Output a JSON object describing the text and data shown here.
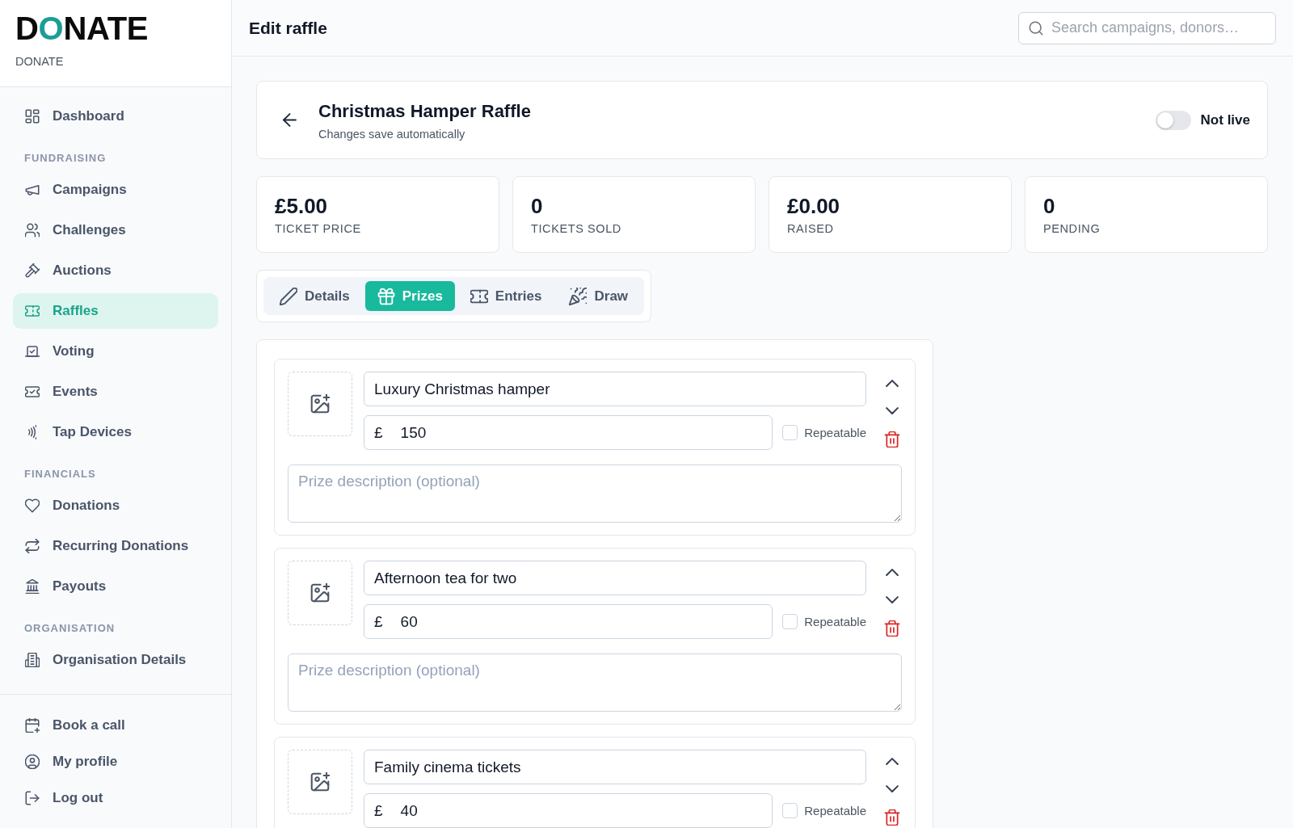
{
  "sidebar": {
    "logo": "DONATE",
    "org_name": "DONATE",
    "nav_groups": [
      {
        "items": [
          {
            "label": "Dashboard",
            "selected": false
          }
        ]
      },
      {
        "heading": "FUNDRAISING",
        "items": [
          {
            "label": "Campaigns",
            "selected": false
          },
          {
            "label": "Challenges",
            "selected": false
          },
          {
            "label": "Auctions",
            "selected": false
          },
          {
            "label": "Raffles",
            "selected": true
          },
          {
            "label": "Voting",
            "selected": false
          },
          {
            "label": "Events",
            "selected": false
          },
          {
            "label": "Tap Devices",
            "selected": false
          }
        ]
      },
      {
        "heading": "FINANCIALS",
        "items": [
          {
            "label": "Donations",
            "selected": false
          },
          {
            "label": "Recurring Donations",
            "selected": false
          },
          {
            "label": "Payouts",
            "selected": false
          }
        ]
      },
      {
        "heading": "ORGANISATION",
        "items": [
          {
            "label": "Organisation Details",
            "selected": false
          }
        ]
      }
    ],
    "footer_links": [
      {
        "label": "Book a call"
      },
      {
        "label": "My profile"
      },
      {
        "label": "Log out"
      }
    ]
  },
  "header": {
    "title": "Edit raffle",
    "search": {
      "placeholder": "Search campaigns, donors…"
    }
  },
  "raffle": {
    "title": "Christmas Hamper Raffle",
    "subtitle": "Changes save automatically",
    "live": false,
    "status": "Not live"
  },
  "stats": [
    {
      "value": "£5.00",
      "label": "TICKET PRICE"
    },
    {
      "value": "0",
      "label": "TICKETS SOLD"
    },
    {
      "value": "£0.00",
      "label": "RAISED"
    },
    {
      "value": "0",
      "label": "PENDING"
    }
  ],
  "tabs": [
    {
      "label": "Details",
      "selected": false
    },
    {
      "label": "Prizes",
      "selected": true
    },
    {
      "label": "Entries",
      "selected": false
    },
    {
      "label": "Draw",
      "selected": false
    }
  ],
  "prizes": [
    {
      "name": "Luxury Christmas hamper",
      "currency": "£",
      "value": "150",
      "repeatable": false,
      "repeatable_label": "Repeatable",
      "description_placeholder": "Prize description (optional)"
    },
    {
      "name": "Afternoon tea for two",
      "currency": "£",
      "value": "60",
      "repeatable": false,
      "repeatable_label": "Repeatable",
      "description_placeholder": "Prize description (optional)"
    },
    {
      "name": "Family cinema tickets",
      "currency": "£",
      "value": "40",
      "repeatable": false,
      "repeatable_label": "Repeatable"
    }
  ]
}
